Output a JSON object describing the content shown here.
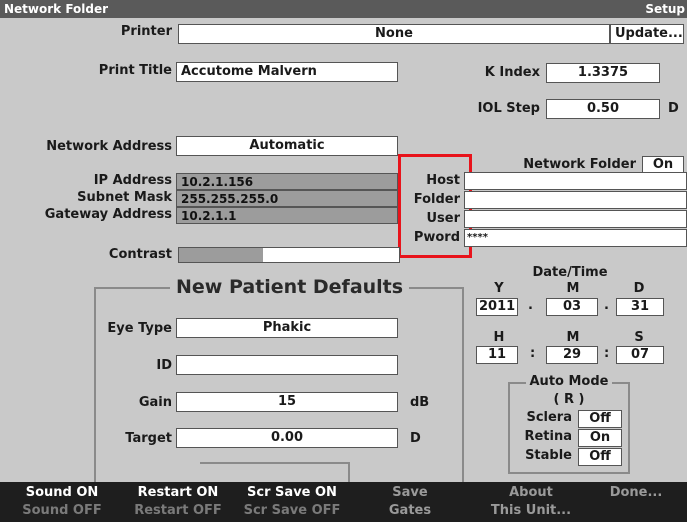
{
  "window": {
    "title": "Network Folder",
    "right_title": "Setup"
  },
  "printer": {
    "label": "Printer",
    "value": "None",
    "update_button": "Update..."
  },
  "print_title": {
    "label": "Print Title",
    "value": "Accutome Malvern"
  },
  "k_index": {
    "label": "K Index",
    "value": "1.3375"
  },
  "iol_step": {
    "label": "IOL Step",
    "value": "0.50",
    "unit": "D"
  },
  "network_address": {
    "label": "Network Address",
    "value": "Automatic"
  },
  "ip_address": {
    "label": "IP Address",
    "value": "10.2.1.156"
  },
  "subnet_mask": {
    "label": "Subnet Mask",
    "value": "255.255.255.0"
  },
  "gateway_address": {
    "label": "Gateway Address",
    "value": "10.2.1.1"
  },
  "network_folder": {
    "label": "Network Folder",
    "toggle": "On",
    "host_label": "Host",
    "host_value": "",
    "folder_label": "Folder",
    "folder_value": "",
    "user_label": "User",
    "user_value": "",
    "pword_label": "Pword",
    "pword_value": "****"
  },
  "contrast": {
    "label": "Contrast",
    "level": 0.38
  },
  "patient_defaults": {
    "title": "New Patient Defaults",
    "eye_type_label": "Eye Type",
    "eye_type_value": "Phakic",
    "id_label": "ID",
    "id_value": "",
    "gain_label": "Gain",
    "gain_value": "15",
    "gain_unit": "dB",
    "target_label": "Target",
    "target_value": "0.00",
    "target_unit": "D"
  },
  "datetime": {
    "title": "Date/Time",
    "y_label": "Y",
    "m_label": "M",
    "d_label": "D",
    "year": "2011",
    "month": "03",
    "day": "31",
    "date_sep": ".",
    "h_label": "H",
    "min_label": "M",
    "s_label": "S",
    "hour": "11",
    "minute": "29",
    "second": "07",
    "time_sep": ":"
  },
  "auto_mode": {
    "title": "Auto Mode",
    "subtitle": "( R )",
    "sclera_label": "Sclera",
    "sclera_value": "Off",
    "retina_label": "Retina",
    "retina_value": "On",
    "stable_label": "Stable",
    "stable_value": "Off"
  },
  "bottom_keys": [
    {
      "top": "Sound ON",
      "bottom": "Sound OFF"
    },
    {
      "top": "Restart ON",
      "bottom": "Restart OFF"
    },
    {
      "top": "Scr Save ON",
      "bottom": "Scr Save OFF"
    },
    {
      "top": "Save",
      "bottom": "Gates"
    },
    {
      "top": "About",
      "bottom": "This Unit..."
    },
    {
      "top": "",
      "bottom": "Done..."
    }
  ],
  "colors": {
    "highlight_box": "#e8131b",
    "background": "#c9c9c9",
    "bottom_bar": "#1e1e1e"
  }
}
